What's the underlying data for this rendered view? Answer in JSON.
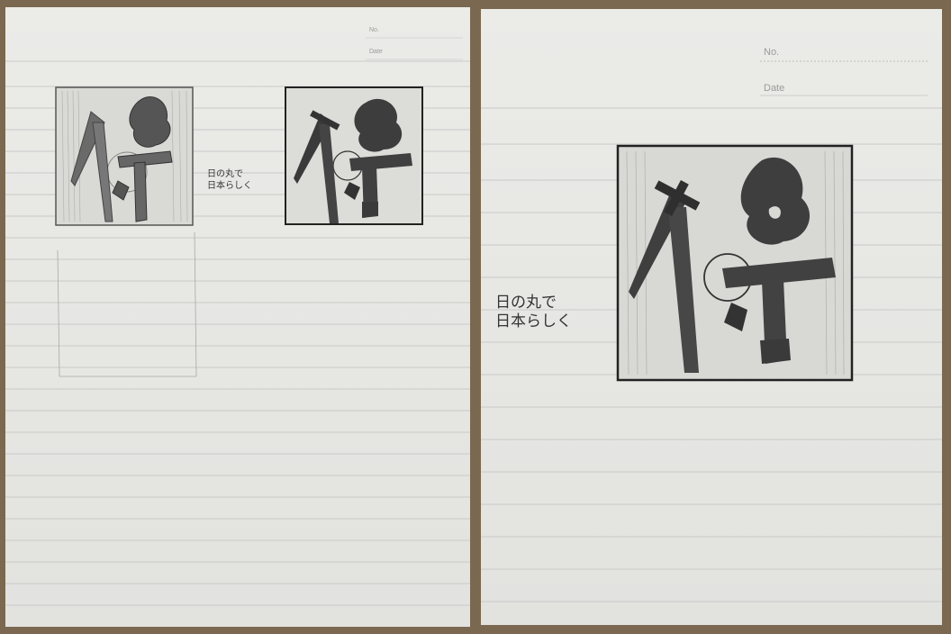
{
  "notebook": {
    "no_label": "No.",
    "date_label": "Date"
  },
  "handwriting": {
    "note_line1": "日の丸で",
    "note_line2": "日本らしく"
  },
  "sketch": {
    "glyph": "侍",
    "ink_color": "#3a3a3a",
    "paper_color": "#e8e8e5",
    "rule_color": "#c9c9c9"
  },
  "photos": [
    {
      "label": "photo-left"
    },
    {
      "label": "photo-right"
    }
  ]
}
